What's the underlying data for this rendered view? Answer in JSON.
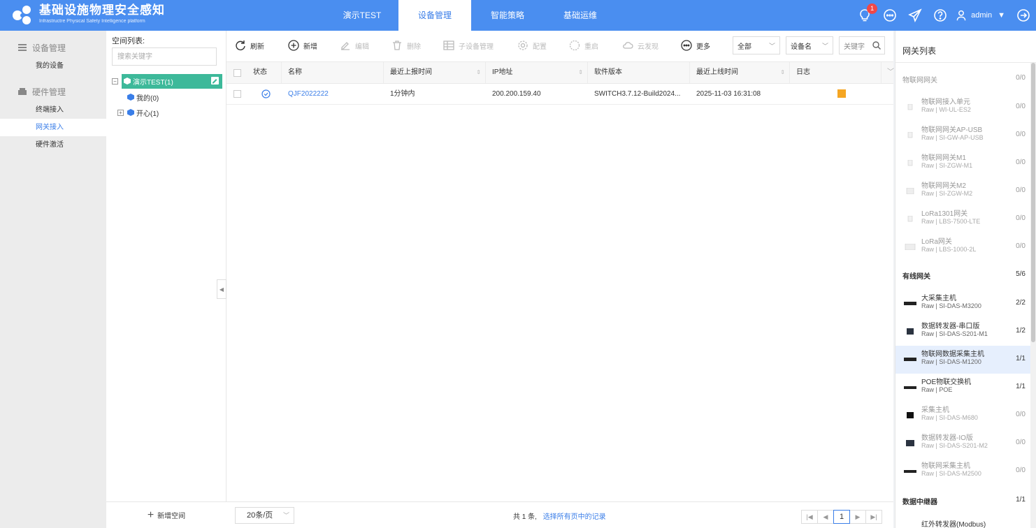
{
  "app": {
    "title": "基础设施物理安全感知",
    "subtitle": "Infrastructre Physical Safety Intelligence platform"
  },
  "nav": {
    "tabs": [
      {
        "label": "演示TEST"
      },
      {
        "label": "设备管理"
      },
      {
        "label": "智能策略"
      },
      {
        "label": "基础运维"
      }
    ],
    "active": "设备管理"
  },
  "header": {
    "notification_count": "1",
    "user": "admin"
  },
  "sidebar": {
    "group1": "设备管理",
    "item1": "我的设备",
    "group2": "硬件管理",
    "item2": "终端接入",
    "item3": "网关接入",
    "item4": "硬件激活"
  },
  "tree": {
    "title": "空间列表:",
    "search_placeholder": "搜索关键字",
    "root": "演示TEST(1)",
    "child1": "我的(0)",
    "child2": "开心(1)",
    "add_space": "新增空间"
  },
  "toolbar": {
    "refresh": "刷新",
    "add": "新增",
    "edit": "编辑",
    "delete": "删除",
    "sub_device": "子设备管理",
    "config": "配置",
    "restart": "重启",
    "cloud": "云发现",
    "more": "更多",
    "filter_all": "全部",
    "filter_field": "设备名",
    "keyword_placeholder": "关键字"
  },
  "table": {
    "columns": {
      "status": "状态",
      "name": "名称",
      "last_report": "最近上报时间",
      "ip": "IP地址",
      "version": "软件版本",
      "last_online": "最近上线时间",
      "log": "日志"
    },
    "rows": [
      {
        "name": "QJF2022222",
        "last_report": "1分钟内",
        "ip": "200.200.159.40",
        "version": "SWITCH3.7.12-Build2024...",
        "last_online": "2025-11-03 16:31:08"
      }
    ]
  },
  "pager": {
    "page_size": "20条/页",
    "total": "共 1 条,",
    "select_all": "选择所有页中的记录",
    "current_page": "1"
  },
  "gateway": {
    "title": "网关列表",
    "cat_iot": {
      "label": "物联网网关",
      "count": "0/0"
    },
    "cat_wired": {
      "label": "有线网关",
      "count": "5/6"
    },
    "cat_relay": {
      "label": "数据中继器",
      "count": "1/1"
    },
    "items": [
      {
        "name": "物联网接入单元",
        "model": "Raw | WI-UL-ES2",
        "count": "0/0"
      },
      {
        "name": "物联网网关AP-USB",
        "model": "Raw | SI-GW-AP-USB",
        "count": "0/0"
      },
      {
        "name": "物联网网关M1",
        "model": "Raw | SI-ZGW-M1",
        "count": "0/0"
      },
      {
        "name": "物联网网关M2",
        "model": "Raw | SI-ZGW-M2",
        "count": "0/0"
      },
      {
        "name": "LoRa1301网关",
        "model": "Raw | LBS-7500-LTE",
        "count": "0/0"
      },
      {
        "name": "LoRa网关",
        "model": "Raw | LBS-1000-2L",
        "count": "0/0"
      },
      {
        "name": "大采集主机",
        "model": "Raw | SI-DAS-M3200",
        "count": "2/2"
      },
      {
        "name": "数据转发器-串口版",
        "model": "Raw | SI-DAS-S201-M1",
        "count": "1/2"
      },
      {
        "name": "物联网数据采集主机",
        "model": "Raw | SI-DAS-M1200",
        "count": "1/1"
      },
      {
        "name": "POE物联交换机",
        "model": "Raw | POE",
        "count": "1/1"
      },
      {
        "name": "采集主机",
        "model": "Raw | SI-DAS-M680",
        "count": "0/0"
      },
      {
        "name": "数据转发器-IO版",
        "model": "Raw | SI-DAS-S201-M2",
        "count": "0/0"
      },
      {
        "name": "物联网采集主机",
        "model": "Raw | SI-DAS-M2500",
        "count": "0/0"
      }
    ],
    "last_partial": "红外转发器(Modbus)"
  },
  "colors": {
    "brand": "#4a8ef0",
    "tree_active": "#3db99a",
    "link": "#3a7ee8",
    "badge": "#f04848",
    "log": "#f5a623"
  }
}
